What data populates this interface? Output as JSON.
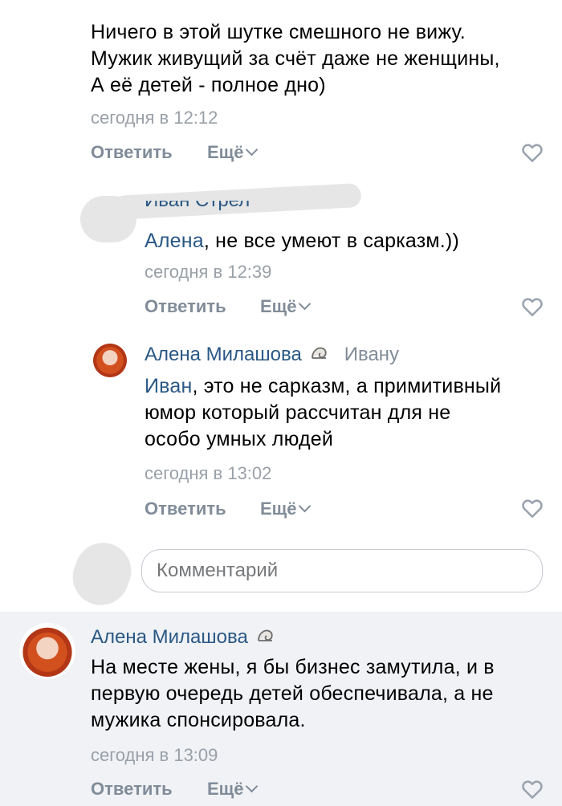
{
  "comments": [
    {
      "author": "",
      "text_lines": [
        "Ничего в этой шутке смешного не вижу.",
        "Мужик живущий за счёт даже не женщины,",
        "А её детей - полное дно)"
      ],
      "time": "сегодня в 12:12",
      "reply_label": "Ответить",
      "more_label": "Ещё"
    },
    {
      "author_fragment": "Иван Стрел",
      "reply_name": "Алена",
      "text_rest": ", не все умеют в сарказм.))",
      "time": "сегодня в 12:39",
      "reply_label": "Ответить",
      "more_label": "Ещё"
    },
    {
      "author": "Алена Милашова",
      "reply_to": "Ивану",
      "reply_name": "Иван",
      "text_line1_rest": ", это не сарказм, а примитивный",
      "text_line2": "юмор который рассчитан для не",
      "text_line3": "особо умных людей",
      "time": "сегодня в 13:02",
      "reply_label": "Ответить",
      "more_label": "Ещё"
    }
  ],
  "comment_input": {
    "placeholder": "Комментарий"
  },
  "bottom_comment": {
    "author": "Алена Милашова",
    "text_lines": [
      "На месте жены, я бы бизнес замутила, и в",
      "первую очередь детей обеспечивала, а не",
      "мужика спонсировала."
    ],
    "time": "сегодня в 13:09",
    "reply_label": "Ответить",
    "more_label": "Ещё"
  },
  "icons": {
    "like": "heart-outline-icon",
    "badge": "snail-shell-icon",
    "more": "chevron-down-icon"
  },
  "colors": {
    "link": "#2a5885",
    "meta": "#9aa0a8",
    "action": "#818c99",
    "highlight_bg": "#f0f2f5"
  }
}
